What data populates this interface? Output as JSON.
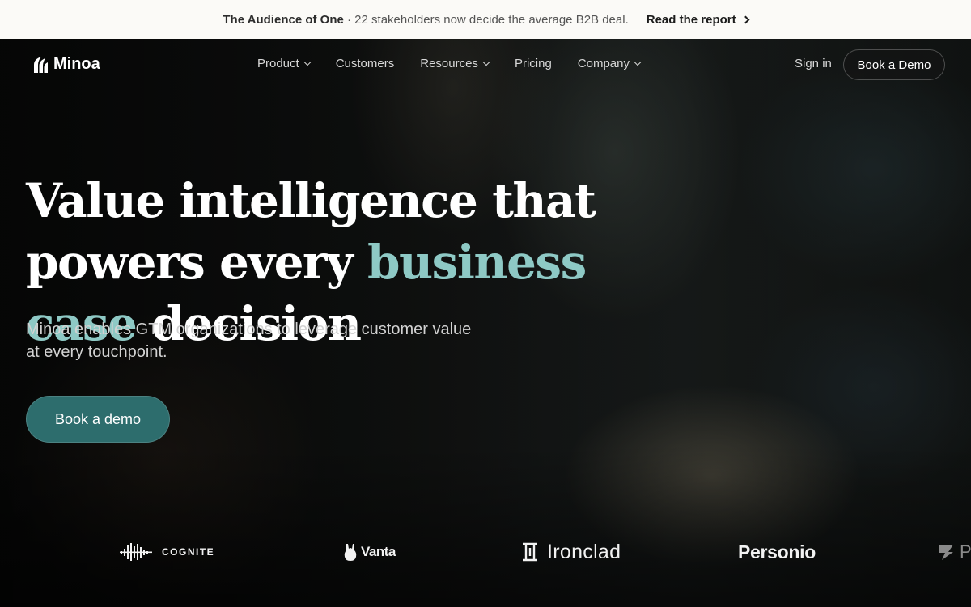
{
  "announcement": {
    "title": "The Audience of One",
    "text": "· 22 stakeholders now decide the average B2B deal.",
    "link_label": "Read the report"
  },
  "brand": {
    "name": "Minoa"
  },
  "nav": {
    "items": [
      {
        "label": "Product",
        "has_dropdown": true
      },
      {
        "label": "Customers",
        "has_dropdown": false
      },
      {
        "label": "Resources",
        "has_dropdown": true
      },
      {
        "label": "Pricing",
        "has_dropdown": false
      },
      {
        "label": "Company",
        "has_dropdown": true
      }
    ],
    "signin_label": "Sign in",
    "demo_label": "Book a Demo"
  },
  "hero": {
    "headline_part1": "Value intelligence that powers every",
    "headline_accent": "business case",
    "headline_part2": "decision",
    "subheadline": "Minoa enables GTM organizations to leverage customer value at every touchpoint.",
    "cta_label": "Book a demo"
  },
  "logos": [
    {
      "name": "COGNITE",
      "icon": "cognite-logo-icon"
    },
    {
      "name": "Vanta",
      "icon": "vanta-logo-icon"
    },
    {
      "name": "Ironclad",
      "icon": "ironclad-logo-icon"
    },
    {
      "name": "Personio",
      "icon": "none"
    },
    {
      "name": "P",
      "icon": "partial-logo-icon"
    }
  ],
  "colors": {
    "accent": "#8ec9c5",
    "cta_background": "#2d6d6d",
    "announcement_background": "#fbfaf7"
  }
}
